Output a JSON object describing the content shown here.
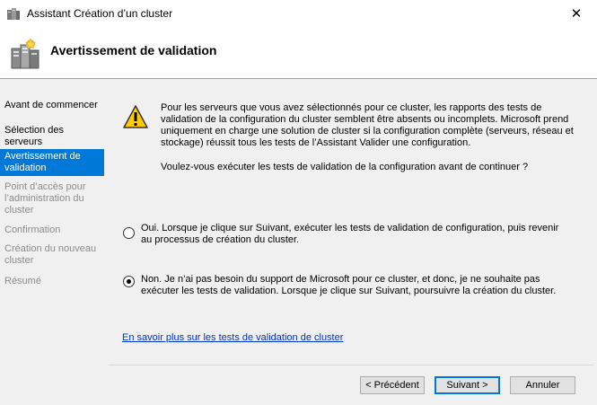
{
  "window": {
    "title": "Assistant Création d’un cluster",
    "close_glyph": "✕"
  },
  "header": {
    "title": "Avertissement de validation",
    "icon": "server-cluster-icon"
  },
  "nav": {
    "items": [
      {
        "label": "Avant de commencer",
        "state": "normal"
      },
      {
        "label": "Sélection des serveurs",
        "state": "normal"
      },
      {
        "label": "Avertissement de validation",
        "state": "selected"
      },
      {
        "label": "Point d’accès pour l’administration du cluster",
        "state": "disabled"
      },
      {
        "label": "Confirmation",
        "state": "disabled"
      },
      {
        "label": "Création du nouveau cluster",
        "state": "disabled"
      },
      {
        "label": "Résumé",
        "state": "disabled"
      }
    ]
  },
  "main": {
    "warning_text": "Pour les serveurs que vous avez sélectionnés pour ce cluster, les rapports des tests de validation de la configuration du cluster semblent être absents ou incomplets. Microsoft prend uniquement en charge une solution de cluster si la configuration complète (serveurs, réseau et stockage) réussit tous les tests de l’Assistant Valider une configuration.",
    "question": "Voulez-vous exécuter les tests de validation de la configuration avant de continuer ?",
    "options": [
      {
        "label": "Oui. Lorsque je clique sur Suivant, exécuter les tests de validation de configuration, puis revenir au processus de création du cluster.",
        "checked": false
      },
      {
        "label": "Non. Je n’ai pas besoin du support de Microsoft pour ce cluster, et donc, je ne souhaite pas exécuter les tests de validation. Lorsque je clique sur Suivant, poursuivre la création du cluster.",
        "checked": true
      }
    ],
    "link": "En savoir plus sur les tests de validation de cluster"
  },
  "buttons": {
    "previous": "< Précédent",
    "next": "Suivant >",
    "cancel": "Annuler"
  },
  "colors": {
    "selection": "#0078d7",
    "link": "#0033cc"
  }
}
